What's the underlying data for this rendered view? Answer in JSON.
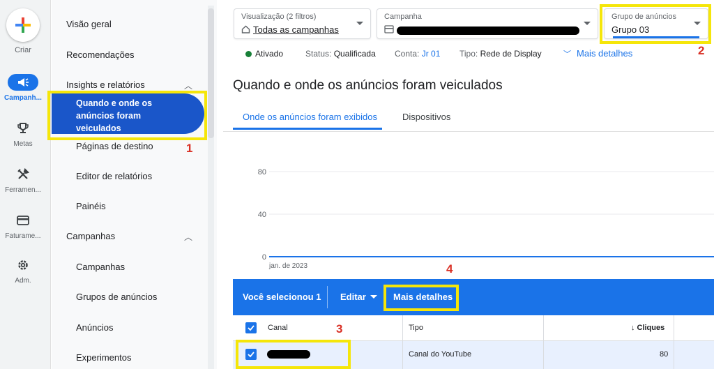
{
  "rail": {
    "create_label": "Criar",
    "items": [
      {
        "label": "Campanh...",
        "icon": "megaphone-icon"
      },
      {
        "label": "Metas",
        "icon": "trophy-icon"
      },
      {
        "label": "Ferramen...",
        "icon": "tools-icon"
      },
      {
        "label": "Faturame...",
        "icon": "credit-card-icon"
      },
      {
        "label": "Adm.",
        "icon": "gear-icon"
      }
    ]
  },
  "sidenav": {
    "overview": "Visão geral",
    "recommendations": "Recomendações",
    "insights_section": "Insights e relatórios",
    "active_item": "Quando e onde os anúncios foram veiculados",
    "landing_pages": "Páginas de destino",
    "report_editor": "Editor de relatórios",
    "dashboards": "Painéis",
    "campaigns_section": "Campanhas",
    "campaigns": "Campanhas",
    "ad_groups": "Grupos de anúncios",
    "ads": "Anúncios",
    "experiments": "Experimentos"
  },
  "filters": {
    "view_caption": "Visualização (2 filtros)",
    "view_value": "Todas as campanhas",
    "campaign_caption": "Campanha",
    "adgroup_caption": "Grupo de anúncios",
    "adgroup_value": "Grupo 03"
  },
  "status": {
    "state": "Ativado",
    "status_label": "Status:",
    "status_value": "Qualificada",
    "account_label": "Conta:",
    "account_value": "Jr 01",
    "type_label": "Tipo:",
    "type_value": "Rede de Display",
    "more_details": "Mais detalhes"
  },
  "page_title": "Quando e onde os anúncios foram veiculados",
  "tabs": [
    "Onde os anúncios foram exibidos",
    "Dispositivos"
  ],
  "chart_data": {
    "type": "line",
    "yticks": [
      "80",
      "40",
      "0"
    ],
    "ylim": [
      0,
      80
    ],
    "x_label": "jan. de 2023",
    "series": [
      {
        "values": [
          0,
          0
        ]
      }
    ]
  },
  "selection_bar": {
    "selected": "Você selecionou 1",
    "edit": "Editar",
    "more_details": "Mais detalhes"
  },
  "table": {
    "headers": {
      "channel": "Canal",
      "type": "Tipo",
      "clicks": "Cliques"
    },
    "rows": [
      {
        "type": "Canal do YouTube",
        "clicks": "80"
      }
    ]
  },
  "annotations": [
    "1",
    "2",
    "3",
    "4"
  ],
  "colors": {
    "accent": "#1a73e8",
    "highlight": "#f5e60a",
    "annotation": "#d93025"
  }
}
